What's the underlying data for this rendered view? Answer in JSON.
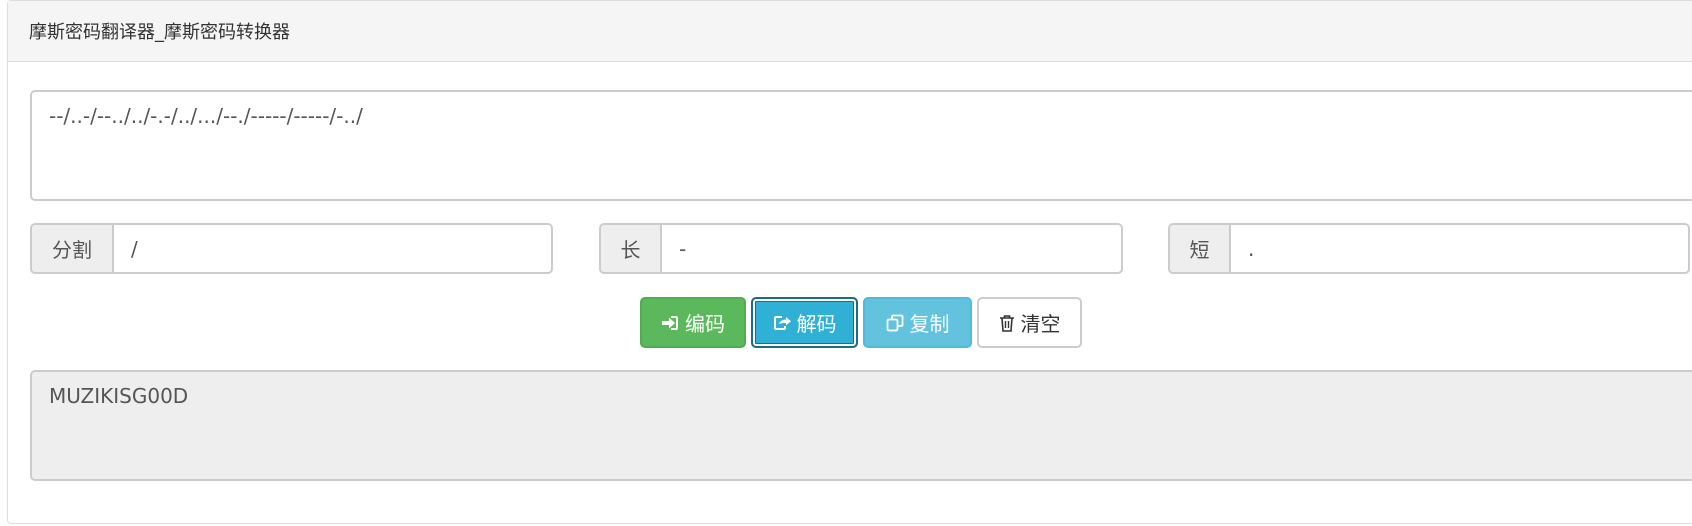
{
  "page": {
    "title": "摩斯密码翻译器_摩斯密码转换器"
  },
  "morse_input": {
    "value": "--/..-/--../../-.-/../.../--./-----/-----/-../"
  },
  "options": {
    "split": {
      "label": "分割",
      "value": "/"
    },
    "long": {
      "label": "长",
      "value": "-"
    },
    "short": {
      "label": "短",
      "value": "."
    }
  },
  "buttons": {
    "encode": {
      "label": "编码",
      "icon": "sign-in-icon"
    },
    "decode": {
      "label": "解码",
      "icon": "share-square-icon"
    },
    "copy": {
      "label": "复制",
      "icon": "copy-icon"
    },
    "clear": {
      "label": "清空",
      "icon": "trash-icon"
    }
  },
  "result": {
    "value": "MUZIKISG00D"
  },
  "colors": {
    "encode": "#5cb85c",
    "decode": "#31b0d5",
    "copy": "#5bc0de",
    "clear": "#ffffff"
  }
}
